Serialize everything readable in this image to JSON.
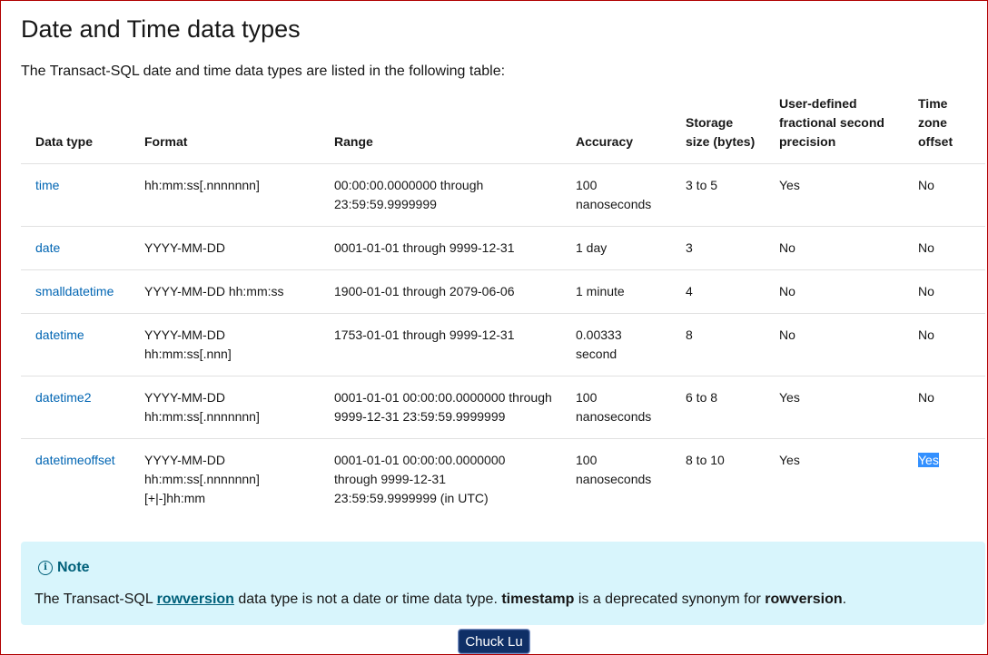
{
  "page": {
    "title": "Date and Time data types",
    "intro": "The Transact-SQL date and time data types are listed in the following table:"
  },
  "table": {
    "headers": {
      "data_type": "Data type",
      "format": "Format",
      "range": "Range",
      "accuracy": "Accuracy",
      "storage": "Storage size (bytes)",
      "precision": "User-defined fractional second precision",
      "tz_offset": "Time zone offset"
    },
    "rows": [
      {
        "type": "time",
        "format": "hh:mm:ss[.nnnnnnn]",
        "range": "00:00:00.0000000 through 23:59:59.9999999",
        "accuracy": "100 nanoseconds",
        "storage": "3 to 5",
        "precision": "Yes",
        "tz": "No"
      },
      {
        "type": "date",
        "format": "YYYY-MM-DD",
        "range": "0001-01-01 through 9999-12-31",
        "accuracy": "1 day",
        "storage": "3",
        "precision": "No",
        "tz": "No"
      },
      {
        "type": "smalldatetime",
        "format": "YYYY-MM-DD hh:mm:ss",
        "range": "1900-01-01 through 2079-06-06",
        "accuracy": "1 minute",
        "storage": "4",
        "precision": "No",
        "tz": "No"
      },
      {
        "type": "datetime",
        "format": "YYYY-MM-DD hh:mm:ss[.nnn]",
        "range": "1753-01-01 through 9999-12-31",
        "accuracy": "0.00333 second",
        "storage": "8",
        "precision": "No",
        "tz": "No"
      },
      {
        "type": "datetime2",
        "format": "YYYY-MM-DD hh:mm:ss[.nnnnnnn]",
        "range": "0001-01-01 00:00:00.0000000 through 9999-12-31 23:59:59.9999999",
        "accuracy": "100 nanoseconds",
        "storage": "6 to 8",
        "precision": "Yes",
        "tz": "No"
      },
      {
        "type": "datetimeoffset",
        "format_lines": [
          "YYYY-MM-DD",
          "hh:mm:ss[.nnnnnnn]",
          "[+|-]hh:mm"
        ],
        "range_lines": [
          "0001-01-01 00:00:00.0000000",
          "through 9999-12-31",
          "23:59:59.9999999 (in UTC)"
        ],
        "accuracy": "100 nanoseconds",
        "storage": "8 to 10",
        "precision": "Yes",
        "tz": "Yes"
      }
    ]
  },
  "note": {
    "title": "Note",
    "icon": "info-icon",
    "text_before": "The Transact-SQL ",
    "link": "rowversion",
    "text_middle": " data type is not a date or time data type. ",
    "bold1": "timestamp",
    "text_after": " is a deprecated synonym for ",
    "bold2": "rowversion",
    "text_end": "."
  },
  "button": {
    "label": "Chuck Lu"
  },
  "colors": {
    "link": "#0065b3",
    "note_bg": "#d8f5fc",
    "note_accent": "#00607a",
    "selection": "#3390ff",
    "button_bg": "#0f2f66",
    "frame_border": "#b00000"
  }
}
